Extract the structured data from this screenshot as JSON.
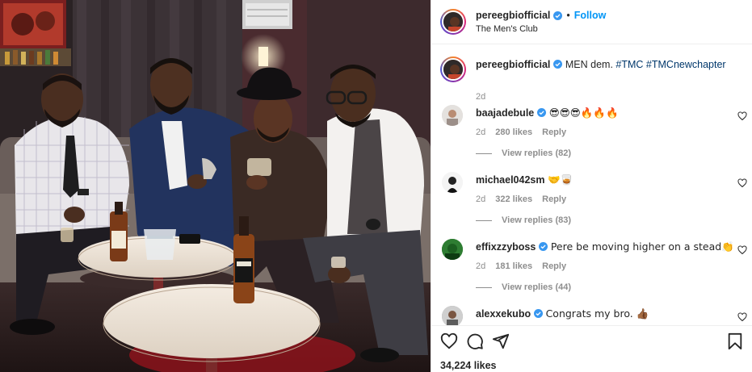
{
  "post": {
    "username": "pereegbiofficial",
    "follow_label": "Follow",
    "dot": "•",
    "location": "The Men's Club"
  },
  "caption": {
    "username": "pereegbiofficial",
    "text": "MEN dem.",
    "hashtags": [
      "#TMC",
      "#TMCnewchapter"
    ],
    "time": "2d"
  },
  "comments": [
    {
      "username": "baajadebule",
      "text": "😎😎😎🔥🔥🔥",
      "time": "2d",
      "likes": "280 likes",
      "reply_label": "Reply",
      "view_replies": "View replies (82)",
      "avatar_color": "#d9d9d9"
    },
    {
      "username": "michael042sm",
      "text": "🤝🥃",
      "time": "2d",
      "likes": "322 likes",
      "reply_label": "Reply",
      "view_replies": "View replies (83)",
      "avatar_color": "#f2f2f2"
    },
    {
      "username": "effixzzyboss",
      "text": "Pere be moving higher on a stead👏",
      "time": "2d",
      "likes": "181 likes",
      "reply_label": "Reply",
      "view_replies": "View replies (44)",
      "avatar_color": "#2e7d32"
    },
    {
      "username": "alexxekubo",
      "text": "Congrats my bro. 👍🏾",
      "time": "",
      "likes": "",
      "reply_label": "",
      "view_replies": "",
      "avatar_color": "#9e9e9e"
    }
  ],
  "actions": {
    "icons": [
      "heart-icon",
      "comment-icon",
      "share-icon",
      "bookmark-icon"
    ]
  },
  "likes_count": "34,224 likes",
  "colors": {
    "accent": "#0095f6",
    "hashtag": "#00376b",
    "muted": "#8e8e8e",
    "verified": "#3897f0"
  }
}
